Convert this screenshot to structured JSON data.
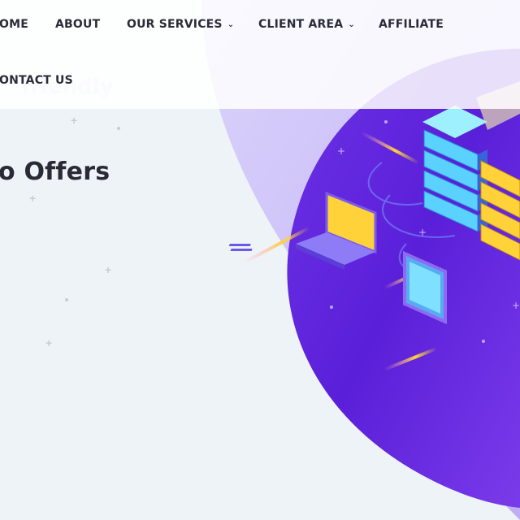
{
  "nav": {
    "items": [
      {
        "label": "OME",
        "has_dropdown": false
      },
      {
        "label": "ABOUT",
        "has_dropdown": false
      },
      {
        "label": "OUR SERVICES",
        "has_dropdown": true
      },
      {
        "label": "CLIENT AREA",
        "has_dropdown": true
      },
      {
        "label": "AFFILIATE",
        "has_dropdown": false
      },
      {
        "label": "ONTACT US",
        "has_dropdown": false
      }
    ],
    "dropdown_glyph": "⌄"
  },
  "hero": {
    "ghost_text": "friendly",
    "title": "o Offers"
  },
  "colors": {
    "purple_deep": "#4a1fd1",
    "purple_mid": "#6a2bd9",
    "purple_light": "#8a5bf0",
    "lavender": "#d6cdfb",
    "cyan": "#5ad1ff",
    "yellow": "#ffd23a"
  },
  "icons": [
    "server-rack-icon",
    "laptop-icon",
    "tablet-icon",
    "sparkle-icon"
  ]
}
